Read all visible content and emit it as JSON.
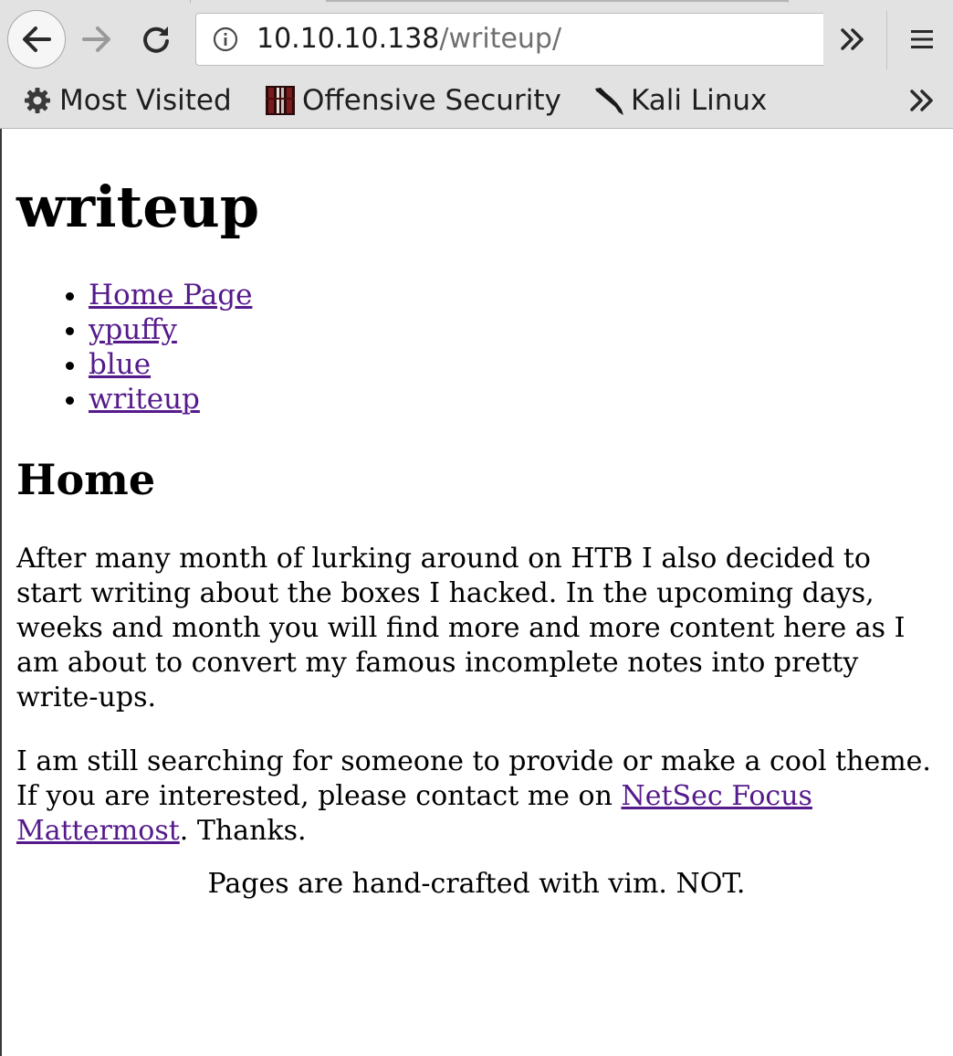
{
  "browser": {
    "url_host": "10.10.10.138",
    "url_path": "/writeup/",
    "bookmarks": [
      {
        "label": "Most Visited",
        "icon": "gear-icon"
      },
      {
        "label": "Offensive Security",
        "icon": "offensive-security-favicon"
      },
      {
        "label": "Kali Linux",
        "icon": "kali-dragon-icon"
      }
    ]
  },
  "page": {
    "title": "writeup",
    "nav_links": [
      "Home Page",
      "ypuffy",
      "blue",
      "writeup"
    ],
    "section_title": "Home",
    "paragraph_1": "After many month of lurking around on HTB I also decided to start writing about the boxes I hacked. In the upcoming days, weeks and month you will find more and more content here as I am about to convert my famous incomplete notes into pretty write-ups.",
    "paragraph_2_before": "I am still searching for someone to provide or make a cool theme. If you are interested, please contact me on ",
    "paragraph_2_link": "NetSec Focus Mattermost",
    "paragraph_2_after": ". Thanks.",
    "footer": "Pages are hand-crafted with vim. NOT."
  },
  "colors": {
    "link": "#551a8b",
    "chrome_bg": "#e2e2e2"
  }
}
